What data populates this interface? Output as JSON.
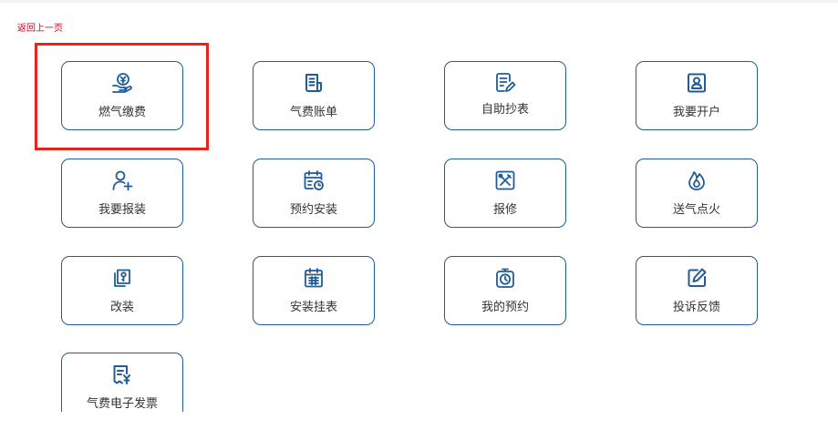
{
  "nav": {
    "back_label": "返回上一页"
  },
  "services": [
    {
      "label": "燃气缴费",
      "icon": "money-hand-icon"
    },
    {
      "label": "气费账单",
      "icon": "bill-icon"
    },
    {
      "label": "自助抄表",
      "icon": "meter-read-icon"
    },
    {
      "label": "我要开户",
      "icon": "account-card-icon"
    },
    {
      "label": "我要报装",
      "icon": "user-add-icon"
    },
    {
      "label": "预约安装",
      "icon": "calendar-clock-icon"
    },
    {
      "label": "报修",
      "icon": "repair-tools-icon"
    },
    {
      "label": "送气点火",
      "icon": "flame-icon"
    },
    {
      "label": "改装",
      "icon": "wrench-icon"
    },
    {
      "label": "安装挂表",
      "icon": "calendar-grid-icon"
    },
    {
      "label": "我的预约",
      "icon": "timer-icon"
    },
    {
      "label": "投诉反馈",
      "icon": "edit-icon"
    },
    {
      "label": "气费电子发票",
      "icon": "invoice-icon"
    }
  ],
  "colors": {
    "accent": "#1f5c99",
    "highlight": "#e8231b",
    "back_link": "#d0021b"
  }
}
